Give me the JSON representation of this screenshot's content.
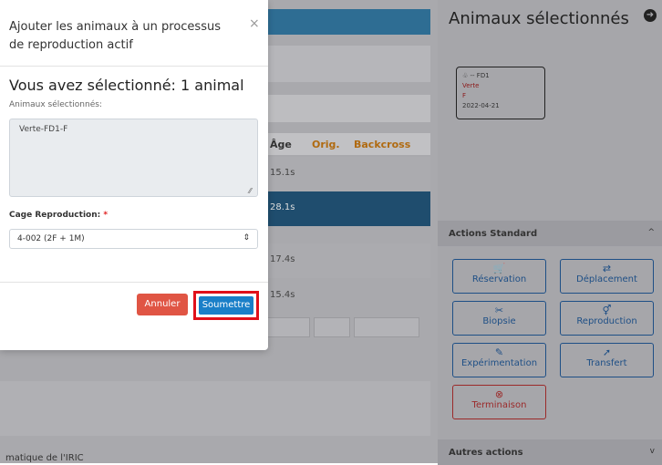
{
  "modal": {
    "title": "Ajouter les animaux à un processus de reproduction actif",
    "close": "×",
    "count_heading": "Vous avez sélectionné: 1 animal",
    "selected_label": "Animaux sélectionnés:",
    "selected_value": "Verte-FD1-F",
    "cage_label": "Cage Reproduction:",
    "cage_required": "*",
    "cage_value": "4-002 (2F + 1M)",
    "cancel_label": "Annuler",
    "submit_label": "Soumettre"
  },
  "background": {
    "columns": [
      "Âge",
      "Orig.",
      "Backcross"
    ],
    "rows": [
      "15.1s",
      "28.1s",
      "17.4s",
      "15.4s"
    ],
    "footer": "matique de l'IRIC"
  },
  "side_panel": {
    "title": "Animaux sélectionnés",
    "card": {
      "line1": "-- FD1",
      "line2": "Verte",
      "line3": "F",
      "line4": "2022-04-21"
    },
    "standard_actions_label": "Actions Standard",
    "other_actions_label": "Autres actions",
    "actions": [
      {
        "label": "Réservation",
        "icon": "cart-icon",
        "glyph": "🛒"
      },
      {
        "label": "Déplacement",
        "icon": "swap-icon",
        "glyph": "⇄"
      },
      {
        "label": "Biopsie",
        "icon": "scissors-icon",
        "glyph": "✂"
      },
      {
        "label": "Reproduction",
        "icon": "gender-icon",
        "glyph": "⚥"
      },
      {
        "label": "Expérimentation",
        "icon": "edit-icon",
        "glyph": "✎"
      },
      {
        "label": "Transfert",
        "icon": "transfer-icon",
        "glyph": "➚"
      },
      {
        "label": "Terminaison",
        "icon": "x-circle-icon",
        "glyph": "⊗"
      }
    ]
  },
  "colors": {
    "submit": "#1a7fc8",
    "cancel": "#e05544",
    "highlight": "#e0101a",
    "brand": "#2e6d93"
  }
}
